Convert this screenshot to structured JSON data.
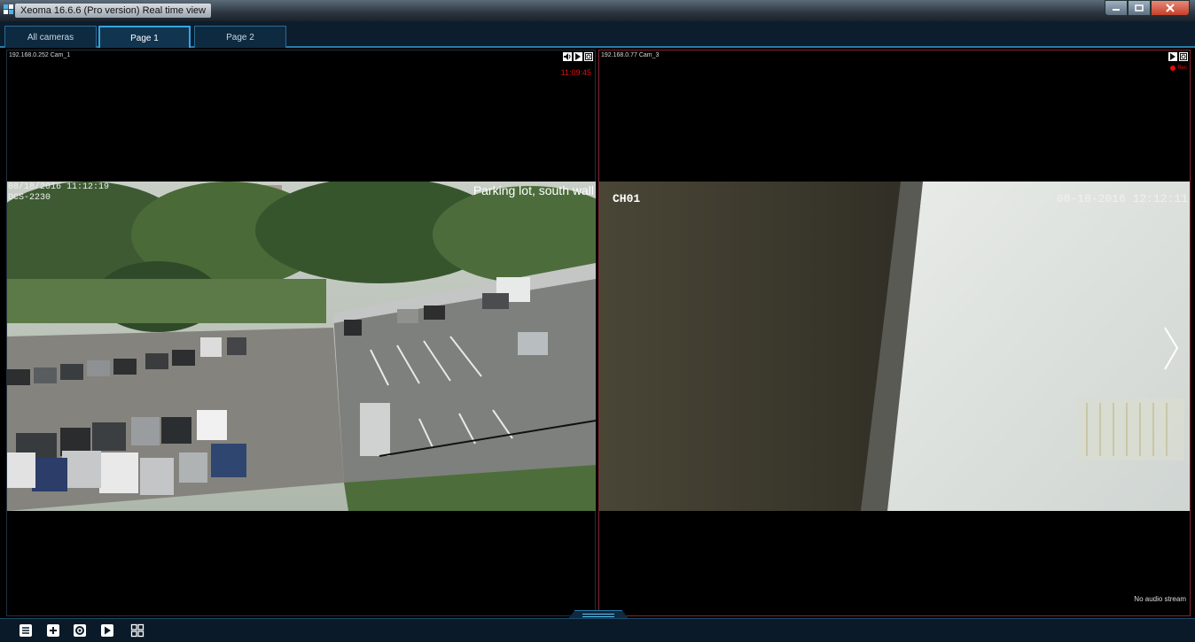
{
  "window": {
    "title": "Xeoma 16.6.6 (Pro version) Real time view"
  },
  "tabs": [
    {
      "label": "All cameras",
      "active": false
    },
    {
      "label": "Page 1",
      "active": true
    },
    {
      "label": "Page 2",
      "active": false
    }
  ],
  "cameras": [
    {
      "name": "192.168.0.252 Cam_1",
      "clock": "11:09:45",
      "osd_datetime": "08/18/2016 11:12:19",
      "osd_line2": "DCS-2230",
      "caption": "Parking lot, south wall"
    },
    {
      "name": "192.168.0.77 Cam_3",
      "rec_label": "Rec",
      "osd_channel": "CH01",
      "osd_datetime": "08-18-2016 12:12:11",
      "audio_status": "No audio stream"
    }
  ],
  "toolbar": [
    "list-icon",
    "add-icon",
    "gear-icon",
    "play-icon",
    "layout-grid-icon"
  ],
  "colors": {
    "accent": "#35a5e0",
    "rec": "#e01010",
    "active_cam_border": "#8a2431"
  }
}
